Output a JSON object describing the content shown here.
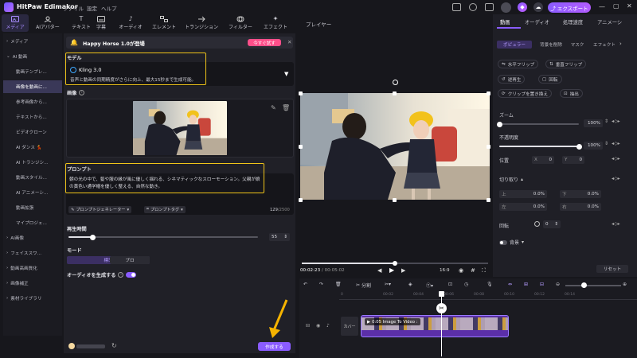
{
  "app": {
    "name": "HitPaw Edimakor",
    "menu": [
      "ファイル",
      "設定",
      "ヘルプ"
    ],
    "export_label": "エクスポート"
  },
  "toolbar": {
    "tabs": [
      {
        "label": "メディア",
        "icon": "media-icon"
      },
      {
        "label": "AIアバター",
        "icon": "avatar-icon"
      },
      {
        "label": "テキスト",
        "icon": "text-icon"
      },
      {
        "label": "字幕",
        "icon": "subtitle-icon"
      },
      {
        "label": "オーディオ",
        "icon": "audio-icon"
      },
      {
        "label": "エレメント",
        "icon": "element-icon"
      },
      {
        "label": "トランジション",
        "icon": "transition-icon"
      },
      {
        "label": "フィルター",
        "icon": "filter-icon"
      },
      {
        "label": "エフェクト",
        "icon": "effect-icon"
      }
    ]
  },
  "sidebar": {
    "items": [
      {
        "label": "メディア",
        "type": "category"
      },
      {
        "label": "AI 動画",
        "type": "category"
      },
      {
        "label": "動画テンプレ...",
        "type": "sub"
      },
      {
        "label": "画像を動画に...",
        "type": "sub",
        "selected": true
      },
      {
        "label": "参考画像から...",
        "type": "sub"
      },
      {
        "label": "テキストから...",
        "type": "sub"
      },
      {
        "label": "ビデオクローン",
        "type": "sub"
      },
      {
        "label": "AI ダンス 💃",
        "type": "sub"
      },
      {
        "label": "AI トランジシ...",
        "type": "sub"
      },
      {
        "label": "動画スタイル...",
        "type": "sub"
      },
      {
        "label": "AI アニメーシ...",
        "type": "sub"
      },
      {
        "label": "動画拡張",
        "type": "sub"
      },
      {
        "label": "マイプロジェ...",
        "type": "sub"
      },
      {
        "label": "AI画像",
        "type": "category"
      },
      {
        "label": "フェイススワ...",
        "type": "category"
      },
      {
        "label": "動画高画質化",
        "type": "category"
      },
      {
        "label": "画像補正",
        "type": "category"
      },
      {
        "label": "素材ライブラリ",
        "type": "category"
      }
    ]
  },
  "panel": {
    "banner_text": "Happy Horse 1.0が登場",
    "try_now": "今すぐ試す",
    "model_label": "モデル",
    "model_name": "Kling 3.0",
    "model_desc": "音声と動画の同期精度がさらに向上、最大15秒まで生成可能。",
    "image_label": "画像",
    "prompt_label": "プロンプト",
    "prompt_text": "朝の光の中で、髪や服の縁が風に優しく揺れる、シネマティックなスローモーション。父親が娘の黄色い通学帽を優しく整える、自然な動き。",
    "prompt_generator": "プロンプトジェネレーター",
    "prompt_tag": "プロンプトタグ",
    "prompt_count": "129",
    "prompt_max": "/2500",
    "duration_label": "再生時間",
    "duration_value": "55",
    "duration_fraction": 0.13,
    "mode_label": "モード",
    "mode_standard": "標準",
    "mode_pro": "プロ",
    "audio_label": "オーディオを生成する",
    "audio_on": true,
    "create_button": "作成する"
  },
  "player": {
    "title": "プレイヤー",
    "current_time": "00:02:23",
    "total_time": "/ 00:05:02",
    "progress": 0.5,
    "aspect": "16:9"
  },
  "right": {
    "tabs": [
      "動画",
      "オーディオ",
      "処理速度",
      "アニメーシ"
    ],
    "subtabs": [
      "ポピュラー",
      "背景を削除",
      "マスク",
      "エフェクト"
    ],
    "buttons": [
      {
        "label": "水平フリップ",
        "icon": "flip-horizontal-icon"
      },
      {
        "label": "垂直フリップ",
        "icon": "flip-vertical-icon"
      },
      {
        "label": "逆再生",
        "icon": "reverse-icon"
      },
      {
        "label": "回転",
        "icon": "rotate-icon"
      },
      {
        "label": "クリップを置き換え",
        "icon": "replace-icon"
      },
      {
        "label": "抽出",
        "icon": "extract-icon"
      }
    ],
    "zoom_label": "ズーム",
    "zoom_value": "100%",
    "zoom_fraction": 0.0,
    "opacity_label": "不透明度",
    "opacity_value": "100%",
    "opacity_fraction": 1.0,
    "position_label": "位置",
    "pos_x_label": "X",
    "pos_x": "0",
    "pos_y_label": "Y",
    "pos_y": "0",
    "crop_label": "切り取り",
    "crop_top_label": "上",
    "crop_top": "0.0%",
    "crop_bottom_label": "下",
    "crop_bottom": "0.0%",
    "crop_left_label": "左",
    "crop_left": "0.0%",
    "crop_right_label": "右",
    "crop_right": "0.0%",
    "rotate_label": "回転",
    "rotate_value": "0",
    "background_label": "背景",
    "reset_label": "リセット"
  },
  "timeline": {
    "split_label": "分割",
    "ruler": [
      "0",
      "00:02",
      "00:04",
      "00:06",
      "00:08",
      "00:10",
      "00:12",
      "00:14"
    ],
    "cover_label": "カバー",
    "clip_label": "0:05 Image To Video :"
  },
  "colors": {
    "accent": "#8a5cff",
    "highlight": "#f0c419",
    "arrow": "#f5b300",
    "try_now": "#ff4f8a"
  }
}
